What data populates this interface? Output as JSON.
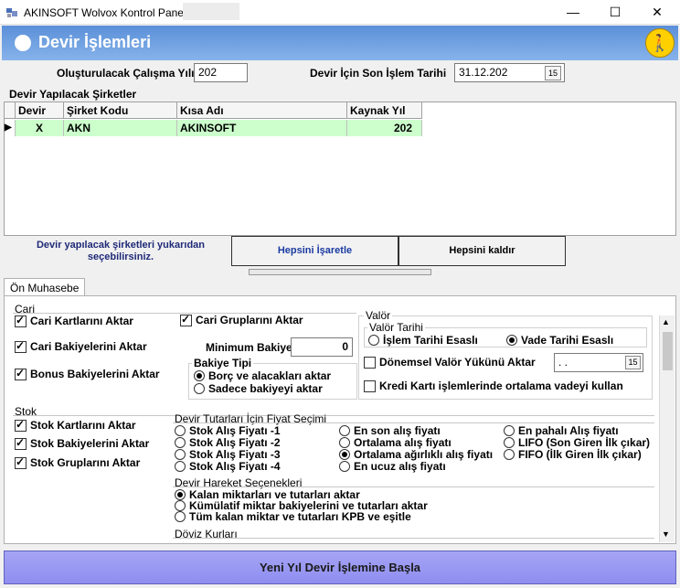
{
  "window": {
    "title": "AKINSOFT Wolvox Kontrol Paneli",
    "minimize": "—",
    "maximize": "☐",
    "close": "✕"
  },
  "header": {
    "title": "Devir İşlemleri",
    "help": "🚶"
  },
  "form": {
    "year_label": "Oluşturulacak Çalışma Yılı",
    "year_value": "202",
    "date_label": "Devir İçin Son İşlem Tarihi",
    "date_value": "31.12.202"
  },
  "companies": {
    "section_label": "Devir Yapılacak Şirketler",
    "columns": [
      "Devir",
      "Şirket Kodu",
      "Kısa Adı",
      "Kaynak Yıl"
    ],
    "rows": [
      {
        "devir": "X",
        "kod": "AKN",
        "ad": "AKINSOFT",
        "yil": "202"
      }
    ],
    "hint": "Devir yapılacak şirketleri yukarıdan seçebilirsiniz.",
    "select_all": "Hepsini İşaretle",
    "clear_all": "Hepsini kaldır"
  },
  "tabs": [
    "Ön Muhasebe"
  ],
  "cari": {
    "title": "Cari",
    "kart": "Cari Kartlarını Aktar",
    "grup": "Cari Gruplarını Aktar",
    "bakiye": "Cari Bakiyelerini Aktar",
    "min_label": "Minimum Bakiye",
    "min_value": "0",
    "bonus": "Bonus Bakiyelerini Aktar",
    "bakiye_tipi": "Bakiye Tipi",
    "tip1": "Borç ve alacakları aktar",
    "tip2": "Sadece bakiyeyi aktar"
  },
  "valor": {
    "title": "Valör",
    "tarih": "Valör Tarihi",
    "islem": "İşlem Tarihi Esaslı",
    "vade": "Vade Tarihi Esaslı",
    "donemsel": "Dönemsel Valör Yükünü Aktar",
    "date_value": " .  .",
    "kredi": "Kredi Kartı işlemlerinde ortalama vadeyi kullan"
  },
  "stok": {
    "title": "Stok",
    "kart": "Stok Kartlarını Aktar",
    "bakiye": "Stok Bakiyelerini Aktar",
    "grup": "Stok Gruplarını Aktar",
    "fiyat_title": "Devir Tutarları İçin Fiyat Seçimi",
    "fiyat": [
      "Stok Alış Fiyatı -1",
      "Stok Alış Fiyatı -2",
      "Stok Alış Fiyatı -3",
      "Stok Alış Fiyatı -4",
      "En son alış fiyatı",
      "Ortalama alış fiyatı",
      "Ortalama ağırlıklı alış fiyatı",
      "En ucuz alış fiyatı",
      "En pahalı Alış fiyatı",
      "LIFO (Son Giren İlk çıkar)",
      "FIFO (İlk Giren İlk çıkar)"
    ],
    "hareket_title": "Devir Hareket Seçenekleri",
    "hareket": [
      "Kalan miktarları ve tutarları aktar",
      "Kümülatif miktar bakiyelerini ve tutarları aktar",
      "Tüm kalan miktar ve tutarları KPB ve eşitle"
    ],
    "doviz": "Döviz Kurları"
  },
  "footer": {
    "start": "Yeni Yıl Devir İşlemine Başla"
  }
}
